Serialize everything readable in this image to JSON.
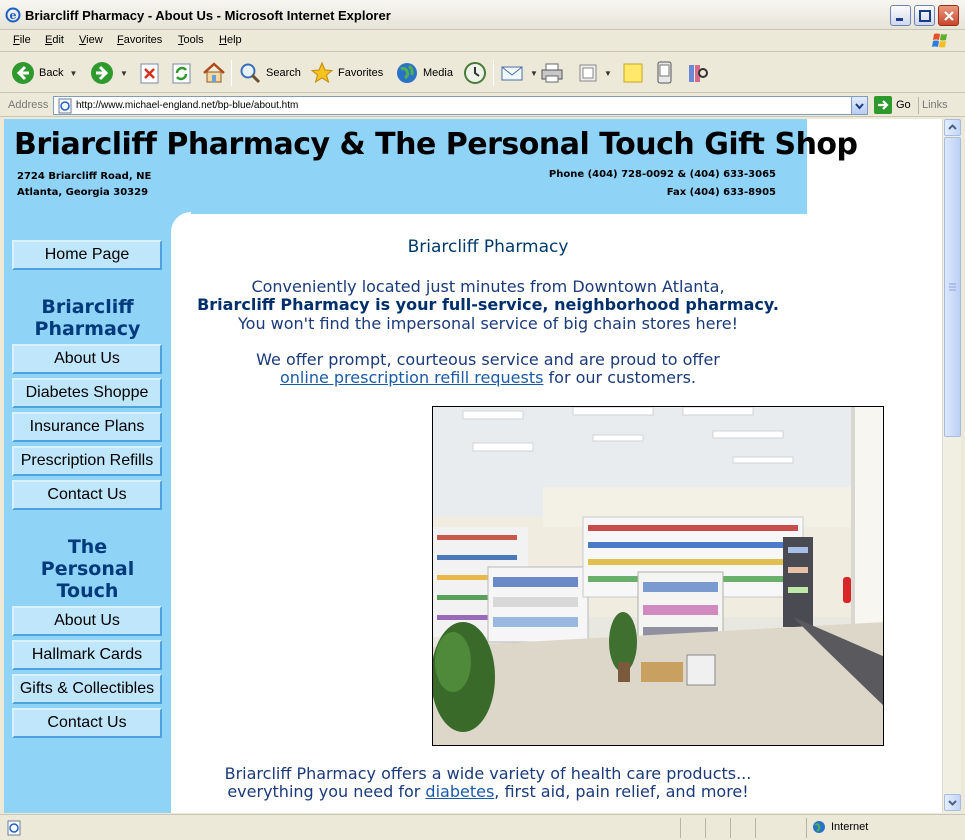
{
  "window": {
    "title": "Briarcliff Pharmacy - About Us - Microsoft Internet Explorer"
  },
  "menu": [
    "File",
    "Edit",
    "View",
    "Favorites",
    "Tools",
    "Help"
  ],
  "toolbar": {
    "back": "Back",
    "search": "Search",
    "favorites": "Favorites",
    "media": "Media"
  },
  "address": {
    "label": "Address",
    "url": "http://www.michael-england.net/bp-blue/about.htm",
    "go": "Go",
    "links": "Links"
  },
  "site": {
    "title": "Briarcliff Pharmacy & The Personal Touch Gift Shop",
    "street": "2724 Briarcliff Road, NE",
    "city": "Atlanta, Georgia 30329",
    "phone": "Phone (404) 728-0092 & (404) 633-3065",
    "fax": "Fax (404) 633-8905"
  },
  "nav": {
    "home": "Home Page",
    "pharmacy_heading_1": "Briarcliff",
    "pharmacy_heading_2": "Pharmacy",
    "pharmacy_items": [
      "About Us",
      "Diabetes Shoppe",
      "Insurance Plans",
      "Prescription Refills",
      "Contact Us"
    ],
    "gift_heading_1": "The",
    "gift_heading_2": "Personal",
    "gift_heading_3": "Touch",
    "gift_items": [
      "About Us",
      "Hallmark Cards",
      "Gifts & Collectibles",
      "Contact Us"
    ]
  },
  "main": {
    "heading": "Briarcliff Pharmacy",
    "intro_1": "Conveniently located just minutes from Downtown Atlanta,",
    "intro_2": "Briarcliff Pharmacy is your full-service, neighborhood pharmacy.",
    "intro_3": "You won't find the impersonal service of big chain stores here!",
    "offer_1": "We offer prompt, courteous service and are proud to offer",
    "offer_link": "online prescription refill requests",
    "offer_2": " for our customers.",
    "products_1": "Briarcliff Pharmacy offers a wide variety of health care products...",
    "products_2a": "everything you need for ",
    "products_link": "diabetes",
    "products_2b": ", first aid, pain relief, and more!"
  },
  "status": {
    "zone": "Internet"
  },
  "colors": {
    "header_blue": "#8fd3f7",
    "heading_navy": "#003a7a",
    "link": "#1a5ba8"
  }
}
